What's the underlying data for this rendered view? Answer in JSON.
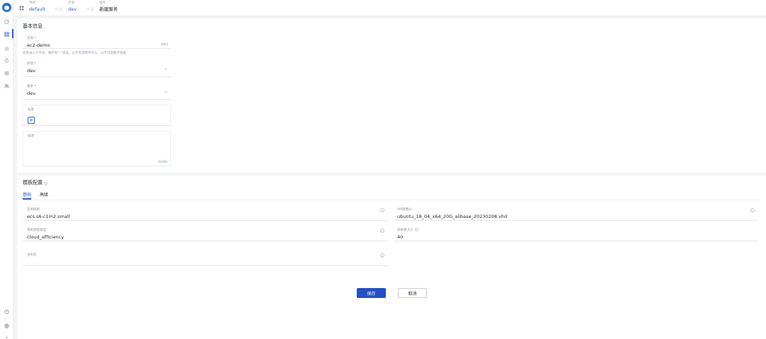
{
  "breadcrumb": {
    "project": {
      "caption": "项目",
      "value": "default"
    },
    "env": {
      "caption": "环境",
      "value": "dev"
    },
    "service": {
      "caption": "服务",
      "value": "新建服务"
    }
  },
  "basic": {
    "title": "基本信息",
    "name": {
      "label": "实例",
      "value": "ec2-demo",
      "count": "8/63",
      "hint": "名称由小写字母、数字和“-”组成，以字母或数字开头，以字母或数字结尾"
    },
    "env": {
      "label": "环境",
      "value": "dev"
    },
    "version": {
      "label": "版本",
      "value": "dev"
    },
    "tags": {
      "label": "标签",
      "add": "+"
    },
    "description": {
      "label": "描述",
      "count": "0/300"
    }
  },
  "template": {
    "title": "模板配置",
    "tabs": [
      "基础",
      "高级"
    ],
    "fields": {
      "instance_type": {
        "label": "实例规格",
        "value": "ecs.s6-c1m2.small"
      },
      "image": {
        "label": "VM镜像id",
        "value": "ubuntu_18_04_x64_20G_alibase_20230208.vhd"
      },
      "disk_category": {
        "label": "系统盘盘类型",
        "value": "cloud_efficiency"
      },
      "disk_size": {
        "label": "系统盘大小",
        "value": "40"
      },
      "hostname": {
        "label": "主机名",
        "value": ""
      }
    }
  },
  "actions": {
    "save": "保存",
    "cancel": "取消"
  },
  "colors": {
    "accent": "#2f5bd6",
    "primary_button": "#2350c8",
    "required": "#d9363e"
  }
}
